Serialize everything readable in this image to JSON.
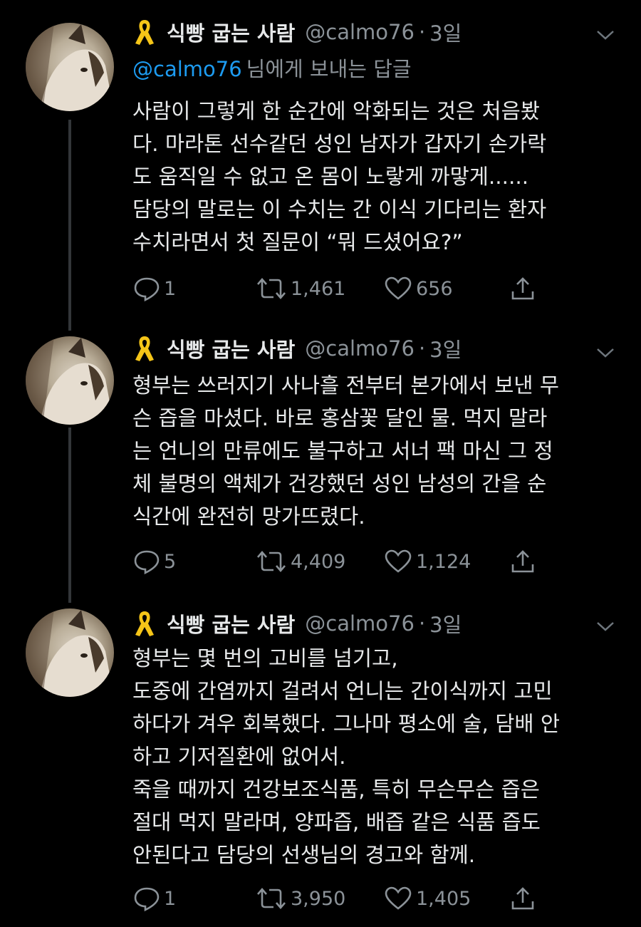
{
  "tweets": [
    {
      "author": {
        "name": "식빵 굽는 사람",
        "handle": "@calmo76"
      },
      "separator": "·",
      "time": "3일",
      "reply_to": {
        "mention": "@calmo76",
        "suffix": "님에게 보내는 답글"
      },
      "lines": [
        "사람이 그렇게 한 순간에 악화되는 것은 처음봤",
        "다. 마라톤 선수같던 성인 남자가 갑자기 손가락",
        "도 움직일 수 없고 온 몸이 노랗게 까맣게......",
        "담당의 말로는 이 수치는 간 이식 기다리는 환자",
        "수치라면서 첫 질문이 “뭐 드셨어요?”"
      ],
      "stats": {
        "replies": "1",
        "retweets": "1,461",
        "likes": "656"
      }
    },
    {
      "author": {
        "name": "식빵 굽는 사람",
        "handle": "@calmo76"
      },
      "separator": "·",
      "time": "3일",
      "lines": [
        "형부는 쓰러지기 사나흘 전부터 본가에서 보낸 무",
        "슨 즙을 마셨다. 바로 홍삼꽃 달인 물. 먹지 말라",
        "는 언니의 만류에도 불구하고 서너 팩 마신 그 정",
        "체 불명의 액체가 건강했던 성인 남성의 간을 순",
        "식간에 완전히 망가뜨렸다."
      ],
      "stats": {
        "replies": "5",
        "retweets": "4,409",
        "likes": "1,124"
      }
    },
    {
      "author": {
        "name": "식빵 굽는 사람",
        "handle": "@calmo76"
      },
      "separator": "·",
      "time": "3일",
      "lines": [
        "형부는 몇 번의 고비를 넘기고,",
        "도중에 간염까지 걸려서 언니는 간이식까지 고민",
        "하다가 겨우 회복했다. 그나마 평소에 술, 담배 안",
        "하고 기저질환에 없어서.",
        "죽을 때까지 건강보조식품, 특히 무슨무슨 즙은",
        "절대 먹지 말라며, 양파즙, 배즙 같은 식품 즙도",
        "안된다고 담당의 선생님의 경고와 함께."
      ],
      "stats": {
        "replies": "1",
        "retweets": "3,950",
        "likes": "1,405"
      }
    }
  ],
  "colors": {
    "background": "#000000",
    "text": "#e7e9ea",
    "secondary": "#8b9298",
    "mention": "#1d9bf0",
    "ribbon": "#f5c518",
    "thread_line": "#333639"
  },
  "icons": {
    "badge": "yellow-ribbon-icon",
    "menu": "chevron-down-icon",
    "reply": "reply-bubble-icon",
    "retweet": "retweet-icon",
    "like": "heart-icon",
    "share": "share-icon"
  }
}
